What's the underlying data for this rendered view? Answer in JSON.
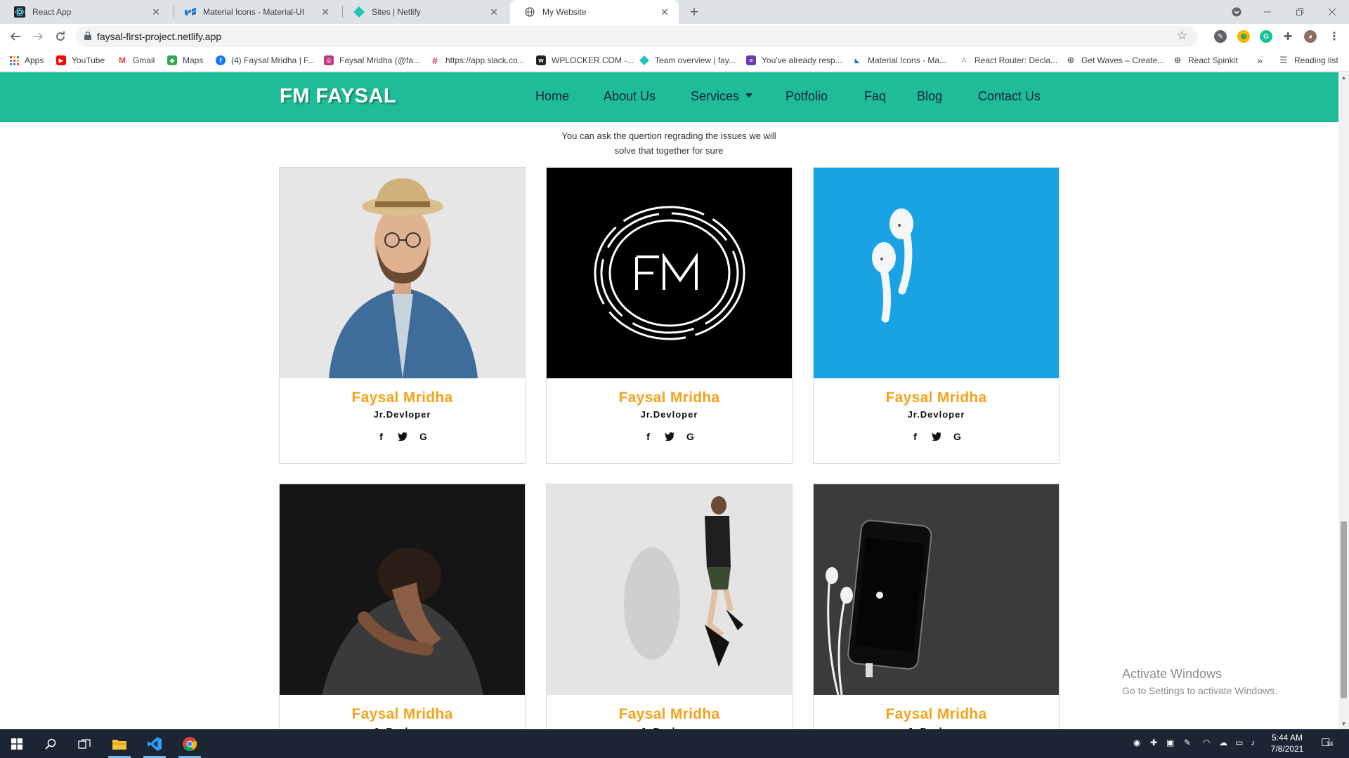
{
  "browser": {
    "tabs": [
      {
        "title": "React App",
        "icon": "react-icon",
        "active": false
      },
      {
        "title": "Material Icons - Material-UI",
        "icon": "material-ui-icon",
        "active": false
      },
      {
        "title": "Sites | Netlify",
        "icon": "netlify-icon",
        "active": false
      },
      {
        "title": "My Website",
        "icon": "globe-icon",
        "active": true
      }
    ],
    "new_tab": "+",
    "url": "faysal-first-project.netlify.app",
    "bookmarks": [
      {
        "label": "Apps",
        "icon": "apps-grid-icon"
      },
      {
        "label": "YouTube",
        "icon": "youtube-icon"
      },
      {
        "label": "Gmail",
        "icon": "gmail-icon"
      },
      {
        "label": "Maps",
        "icon": "maps-icon"
      },
      {
        "label": "(4) Faysal Mridha | F...",
        "icon": "facebook-icon"
      },
      {
        "label": "Faysal Mridha (@fa...",
        "icon": "instagram-icon"
      },
      {
        "label": "https://app.slack.co...",
        "icon": "slack-icon"
      },
      {
        "label": "WPLOCKER.COM -...",
        "icon": "wplocker-icon"
      },
      {
        "label": "Team overview | fay...",
        "icon": "diamond-icon"
      },
      {
        "label": "You've already resp...",
        "icon": "forms-icon"
      },
      {
        "label": "Material Icons - Ma...",
        "icon": "material-ui-icon"
      },
      {
        "label": "React Router: Decla...",
        "icon": "react-router-icon"
      },
      {
        "label": "Get Waves – Create...",
        "icon": "globe-icon"
      },
      {
        "label": "React Spinkit",
        "icon": "globe-icon"
      }
    ],
    "bookmarks_overflow": "»",
    "reading_list": "Reading list"
  },
  "site": {
    "brand": "FM FAYSAL",
    "nav": [
      {
        "label": "Home"
      },
      {
        "label": "About Us"
      },
      {
        "label": "Services",
        "dropdown": true
      },
      {
        "label": "Potfolio"
      },
      {
        "label": "Faq"
      },
      {
        "label": "Blog"
      },
      {
        "label": "Contact Us"
      }
    ],
    "intro_line1": "You can ask the quertion regrading the issues we will",
    "intro_line2": "solve that together for sure",
    "team": [
      {
        "name": "Faysal Mridha",
        "role": "Jr.Devloper",
        "photo": "man-with-hat-photo"
      },
      {
        "name": "Faysal Mridha",
        "role": "Jr.Devloper",
        "photo": "fm-logo-photo"
      },
      {
        "name": "Faysal Mridha",
        "role": "Jr.Devloper",
        "photo": "airpods-photo"
      },
      {
        "name": "Faysal Mridha",
        "role": "Jr.Devloper",
        "photo": "man-in-dark-photo"
      },
      {
        "name": "Faysal Mridha",
        "role": "Jr.Devloper",
        "photo": "jumping-man-photo"
      },
      {
        "name": "Faysal Mridha",
        "role": "Jr.Devloper",
        "photo": "iphone-photo"
      }
    ],
    "socials": [
      "f",
      "t",
      "G"
    ],
    "colors": {
      "navbar": "#1fbc98",
      "accent": "#f5a31a"
    }
  },
  "os": {
    "watermark_title": "Activate Windows",
    "watermark_sub": "Go to Settings to activate Windows.",
    "time": "5:44 AM",
    "date": "7/8/2021",
    "notifications": "14"
  }
}
